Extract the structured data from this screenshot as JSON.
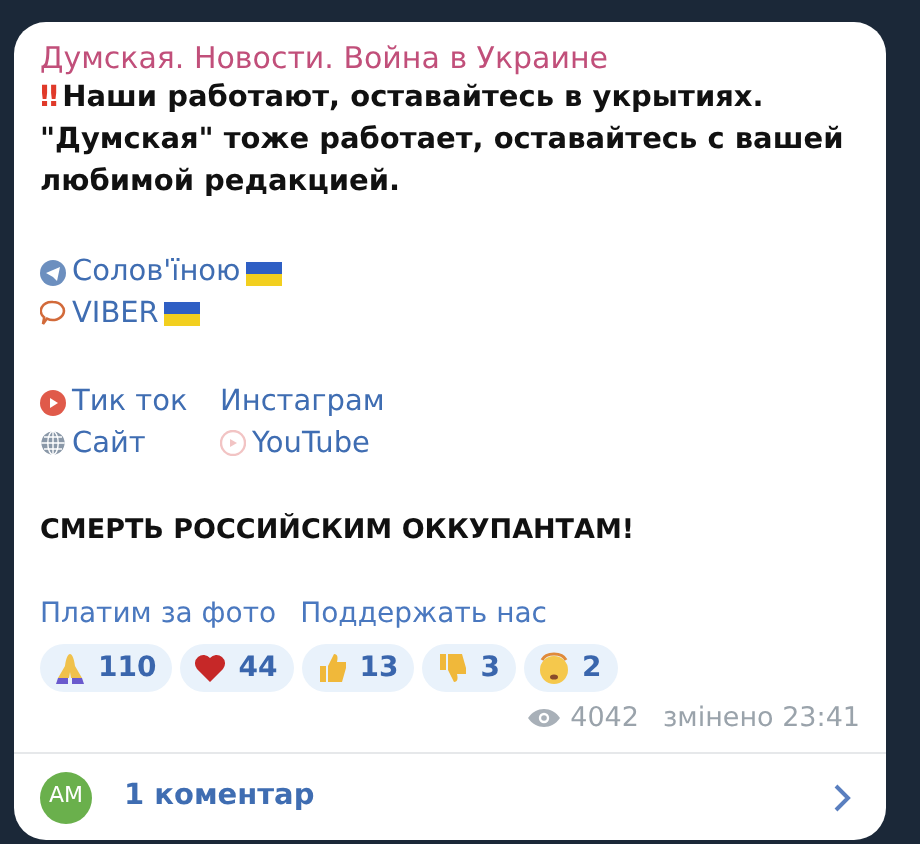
{
  "channel": {
    "name": "Думская. Новости. Война в Украине"
  },
  "message": {
    "alert": "‼",
    "text": "Наши работают, оставайтесь в укрытиях. \"Думская\" тоже работает, оставайтесь с вашей любимой редакцией."
  },
  "links": [
    {
      "kind": "telegram",
      "label": "Солов'їною",
      "flag": true
    },
    {
      "kind": "viber",
      "label": "VIBER",
      "flag": true
    }
  ],
  "social": [
    {
      "kind": "tiktok",
      "label": "Тик ток"
    },
    {
      "kind": "instagram",
      "label": "Инстаграм"
    },
    {
      "kind": "site",
      "label": "Сайт"
    },
    {
      "kind": "youtube",
      "label": "YouTube"
    }
  ],
  "slogan": "СМЕРТЬ РОССИЙСКИМ ОККУПАНТАМ!",
  "buttons": [
    "Платим за фото",
    "Поддержать нас"
  ],
  "reactions": [
    {
      "kind": "pray",
      "count": "110"
    },
    {
      "kind": "heart",
      "count": "44"
    },
    {
      "kind": "thumbs-up",
      "count": "13"
    },
    {
      "kind": "thumbs-down",
      "count": "3"
    },
    {
      "kind": "face",
      "count": "2"
    }
  ],
  "views": "4042",
  "edited": "змінено 23:41",
  "comments": {
    "avatar": "AM",
    "label": "1 коментар"
  }
}
